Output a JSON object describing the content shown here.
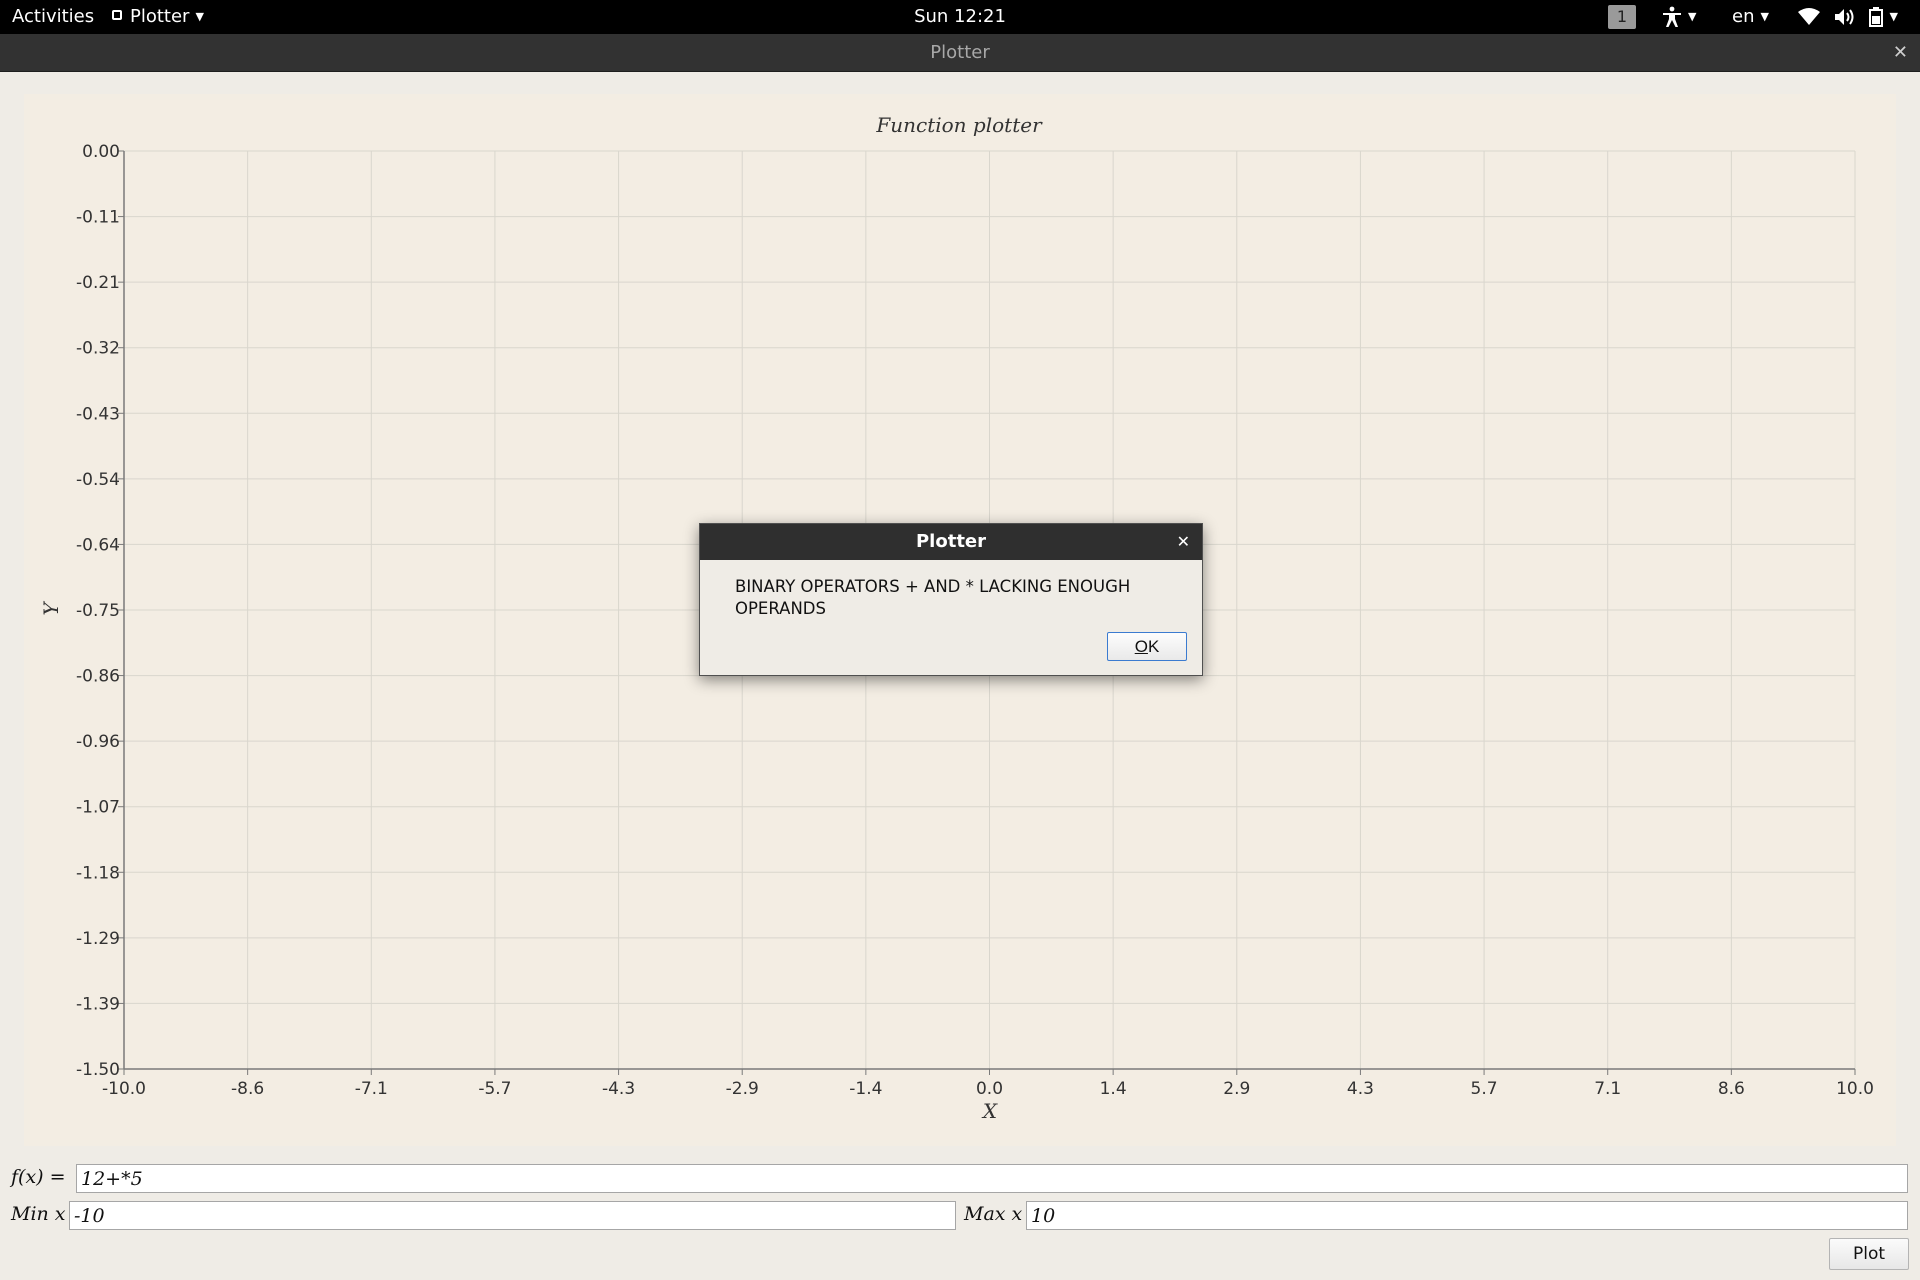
{
  "topbar": {
    "activities": "Activities",
    "app_menu": "Plotter",
    "clock": "Sun 12:21",
    "workspace": "1",
    "language": "en"
  },
  "window": {
    "title": "Plotter"
  },
  "chart_data": {
    "type": "line",
    "title": "Function plotter",
    "xlabel": "X",
    "ylabel": "Y",
    "xlim": [
      -10.0,
      10.0
    ],
    "ylim": [
      -1.5,
      0.0
    ],
    "x_ticks": [
      "-10.0",
      "-8.6",
      "-7.1",
      "-5.7",
      "-4.3",
      "-2.9",
      "-1.4",
      "0.0",
      "1.4",
      "2.9",
      "4.3",
      "5.7",
      "7.1",
      "8.6",
      "10.0"
    ],
    "y_ticks": [
      "0.00",
      "-0.11",
      "-0.21",
      "-0.32",
      "-0.43",
      "-0.54",
      "-0.64",
      "-0.75",
      "-0.86",
      "-0.96",
      "-1.07",
      "-1.18",
      "-1.29",
      "-1.39",
      "-1.50"
    ],
    "grid": true,
    "series": []
  },
  "controls": {
    "fx_label": "f(x) =",
    "fx_value": "12+*5",
    "minx_label": "Min x",
    "minx_value": "-10",
    "maxx_label": "Max x",
    "maxx_value": "10",
    "plot_button": "Plot"
  },
  "dialog": {
    "title": "Plotter",
    "message": "BINARY OPERATORS + AND * LACKING ENOUGH OPERANDS",
    "ok_label": "OK"
  },
  "colors": {
    "plot_background": "#f3ede3",
    "grid": "#d9d6cd",
    "axis": "#7a7a7a"
  }
}
